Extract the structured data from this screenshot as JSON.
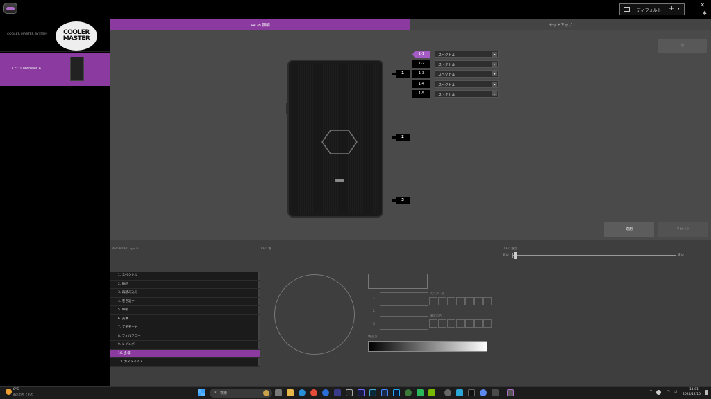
{
  "titlebar": {
    "profile_name": "ディフォルト",
    "add_glyph": "+",
    "caret_glyph": "▾",
    "close_glyph": "✕",
    "pin_glyph": "✱"
  },
  "sidebar": {
    "system_label": "COOLER MASTER SYSTEM",
    "logo_line1": "COOLER",
    "logo_line2": "MASTER",
    "device_label": "LED Controller A1"
  },
  "tabs": {
    "argb": "ARGB 照明",
    "setup": "セットアップ"
  },
  "upper": {
    "top_right_button": "管",
    "ports": [
      "1",
      "2",
      "3"
    ],
    "channels": [
      {
        "tag": "1-1",
        "value": "スペクトル",
        "active": true
      },
      {
        "tag": "1-2",
        "value": "スペクトル",
        "active": false
      },
      {
        "tag": "1-3",
        "value": "スペクトル",
        "active": false
      },
      {
        "tag": "1-4",
        "value": "スペクトル",
        "active": false
      },
      {
        "tag": "1-5",
        "value": "スペクトル",
        "active": false
      }
    ],
    "apply_label": "適用",
    "reset_label": "リセット"
  },
  "lower": {
    "mode_label": "ARGB LED モード",
    "color_label": "LED 色",
    "speed_label": "LED 速度",
    "speed_slow": "遅い",
    "speed_fast": "速い",
    "speed_value": 0,
    "modes": [
      "1. スペクトル",
      "2. 静的",
      "3. 再読み込み",
      "4. 巻き返す",
      "5. 呼吸",
      "6. 充填",
      "7. デモモード",
      "8. フィルフロー",
      "9. レインボー",
      "10. 多様",
      "11. カスタマイズ"
    ],
    "selected_mode_index": 9,
    "rgb_labels": [
      "1",
      "2",
      "3"
    ],
    "preset_label_1": "カスタム色",
    "preset_label_2": "最近の色",
    "brightness_label": "明るさ"
  },
  "taskbar": {
    "weather_temp": "8°C",
    "weather_desc": "晴れのち くもり",
    "search_placeholder": "検索",
    "time": "11:01",
    "date": "2024/12/10"
  },
  "colors": {
    "accent": "#8b3a9f",
    "active_tag": "#a55bc4"
  }
}
